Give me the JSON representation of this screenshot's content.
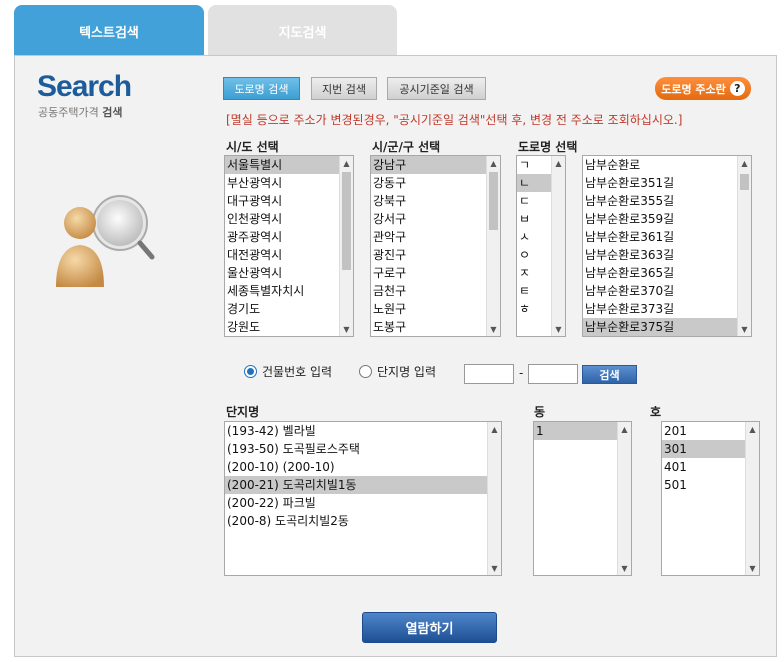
{
  "tabs": {
    "text_search": "텍스트검색",
    "map_search": "지도검색"
  },
  "logo": {
    "title": "Search",
    "sub_main": "공동주택가격",
    "sub_bold": "검색"
  },
  "search_buttons": {
    "road": "도로명 검색",
    "lot": "지번 검색",
    "date": "공시기준일 검색"
  },
  "road_address_button": {
    "label": "도로명 주소란",
    "help": "?"
  },
  "notice": "[멸실 등으로 주소가 변경된경우, \"공시기준일 검색\"선택 후, 변경 전 주소로 조회하십시오.]",
  "labels": {
    "sido": "시/도 선택",
    "sigungu": "시/군/구 선택",
    "road": "도로명 선택",
    "complex": "단지명",
    "dong": "동",
    "ho": "호"
  },
  "sido_list": [
    "서울특별시",
    "부산광역시",
    "대구광역시",
    "인천광역시",
    "광주광역시",
    "대전광역시",
    "울산광역시",
    "세종특별자치시",
    "경기도",
    "강원도"
  ],
  "sido_selected": 0,
  "sigungu_list": [
    "강남구",
    "강동구",
    "강북구",
    "강서구",
    "관악구",
    "광진구",
    "구로구",
    "금천구",
    "노원구",
    "도봉구"
  ],
  "sigungu_selected": 0,
  "initial_list": [
    "ㄱ",
    "ㄴ",
    "ㄷ",
    "ㅂ",
    "ㅅ",
    "ㅇ",
    "ㅈ",
    "ㅌ",
    "ㅎ"
  ],
  "initial_selected": 1,
  "road_list": [
    "남부순환로",
    "남부순환로351길",
    "남부순환로355길",
    "남부순환로359길",
    "남부순환로361길",
    "남부순환로363길",
    "남부순환로365길",
    "남부순환로370길",
    "남부순환로373길",
    "남부순환로375길"
  ],
  "road_selected": 9,
  "input_mode": {
    "building": "건물번호 입력",
    "complex": "단지명 입력"
  },
  "number_inputs": {
    "first": "",
    "second": "",
    "dash": "-"
  },
  "search_button": "검색",
  "complex_list": [
    "(193-42) 벨라빌",
    "(193-50) 도곡필로스주택",
    "(200-10) (200-10)",
    "(200-21) 도곡리치빌1동",
    "(200-22) 파크빌",
    "(200-8) 도곡리치빌2동"
  ],
  "complex_selected": 3,
  "dong_list": [
    "1"
  ],
  "dong_selected": 0,
  "ho_list": [
    "201",
    "301",
    "401",
    "501"
  ],
  "ho_selected": 1,
  "view_button": "열람하기"
}
